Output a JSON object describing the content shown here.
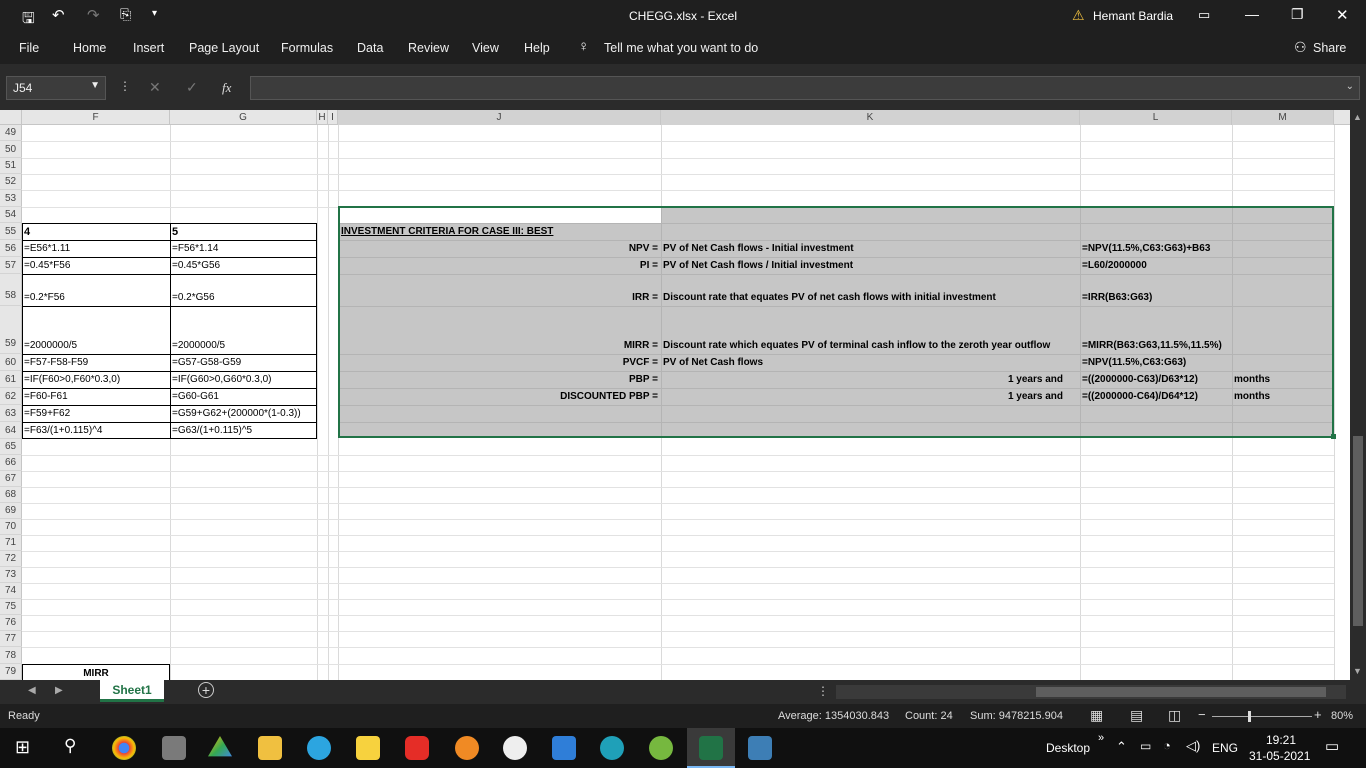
{
  "titlebar": {
    "title": "CHEGG.xlsx  -  Excel",
    "user": "Hemant Bardia",
    "warn": "⚠"
  },
  "ribbon": {
    "tabs": [
      "File",
      "Home",
      "Insert",
      "Page Layout",
      "Formulas",
      "Data",
      "Review",
      "View",
      "Help"
    ],
    "tell": "Tell me what you want to do",
    "share": "Share"
  },
  "formula_bar": {
    "namebox": "J54",
    "fx": "fx"
  },
  "columns": {
    "F": "F",
    "G": "G",
    "H": "H",
    "I": "I",
    "J": "J",
    "K": "K",
    "L": "L",
    "M": "M"
  },
  "rows": [
    "49",
    "50",
    "51",
    "52",
    "53",
    "54",
    "55",
    "56",
    "57",
    "58",
    "59",
    "60",
    "61",
    "62",
    "63",
    "64",
    "65",
    "66",
    "67",
    "68",
    "69",
    "70",
    "71",
    "72",
    "73",
    "74",
    "75",
    "76",
    "77",
    "78",
    "79"
  ],
  "cells": {
    "F55": "4",
    "G55": "5",
    "F56": "=E56*1.11",
    "G56": "=F56*1.14",
    "F57": "=0.45*F56",
    "G57": "=0.45*G56",
    "F58": "=0.2*F56",
    "G58": "=0.2*G56",
    "F59": "=2000000/5",
    "G59": "=2000000/5",
    "F60": "=F57-F58-F59",
    "G60": "=G57-G58-G59",
    "F61": "=IF(F60>0,F60*0.3,0)",
    "G61": "=IF(G60>0,G60*0.3,0)",
    "F62": "=F60-F61",
    "G62": "=G60-G61",
    "F63": "=F59+F62",
    "G63": "=G59+G62+(200000*(1-0.3))",
    "F64": "=F63/(1+0.115)^4",
    "G64": "=G63/(1+0.115)^5",
    "F79": "MIRR",
    "J55": "INVESTMENT CRITERIA FOR CASE III: BEST",
    "J56": "NPV =",
    "K56": "PV of Net Cash flows - Initial investment",
    "L56": "=NPV(11.5%,C63:G63)+B63",
    "J57": "PI =",
    "K57": "PV of Net Cash flows / Initial investment",
    "L57": "=L60/2000000",
    "J58": "IRR =",
    "K58": "Discount rate that equates PV of net cash flows with initial investment",
    "L58": "=IRR(B63:G63)",
    "J59": "MIRR =",
    "K59": "Discount rate which equates PV of terminal cash inflow to the zeroth year outflow",
    "L59": "=MIRR(B63:G63,11.5%,11.5%)",
    "J60": "PVCF =",
    "K60": "PV of Net Cash flows",
    "L60": "=NPV(11.5%,C63:G63)",
    "J61": "PBP =",
    "K61": "1 years and",
    "L61": "=((2000000-C63)/D63*12)",
    "M61": "months",
    "J62": "DISCOUNTED PBP =",
    "K62": "1 years and",
    "L62": "=((2000000-C64)/D64*12)",
    "M62": "months"
  },
  "sheet_tab": "Sheet1",
  "status": {
    "ready": "Ready",
    "average": "Average: 1354030.843",
    "count": "Count: 24",
    "sum": "Sum: 9478215.904",
    "zoom": "80%"
  },
  "taskbar": {
    "desktop": "Desktop",
    "lang": "ENG",
    "time": "19:21",
    "date": "31-05-2021"
  },
  "colors": {
    "excel_green": "#217346",
    "selection_fill": "#c6c6c6"
  }
}
